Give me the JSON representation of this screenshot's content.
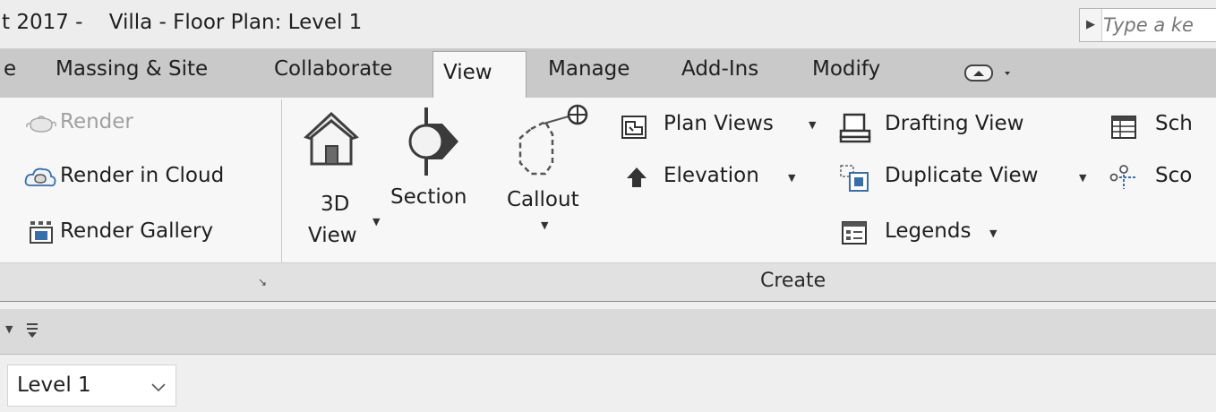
{
  "titlebar": {
    "title": "t 2017 -    Villa - Floor Plan: Level 1",
    "search_placeholder": "Type a ke"
  },
  "tabs": [
    {
      "label": "e"
    },
    {
      "label": "Massing & Site"
    },
    {
      "label": "Collaborate"
    },
    {
      "label": "View",
      "active": true
    },
    {
      "label": "Manage"
    },
    {
      "label": "Add-Ins"
    },
    {
      "label": "Modify"
    }
  ],
  "ribbon": {
    "graphics_panel": {
      "render": "Render",
      "render_in_cloud": "Render  in Cloud",
      "render_gallery": "Render  Gallery"
    },
    "create_panel": {
      "view_3d_line1": "3D",
      "view_3d_line2": "View",
      "section": "Section",
      "callout": "Callout",
      "plan_views": "Plan  Views",
      "elevation": "Elevation",
      "drafting_view": "Drafting  View",
      "duplicate_view": "Duplicate  View",
      "legends": "Legends",
      "schedules": "Sch",
      "scope_box": "Sco",
      "panel_title": "Create"
    }
  },
  "level_selector": {
    "value": "Level 1"
  },
  "colors": {
    "tab_bar": "#c9c9c9",
    "ribbon_bg": "#f7f7f7",
    "panel_bar": "#e1e1e1",
    "accent_blue": "#3a6ea8"
  }
}
